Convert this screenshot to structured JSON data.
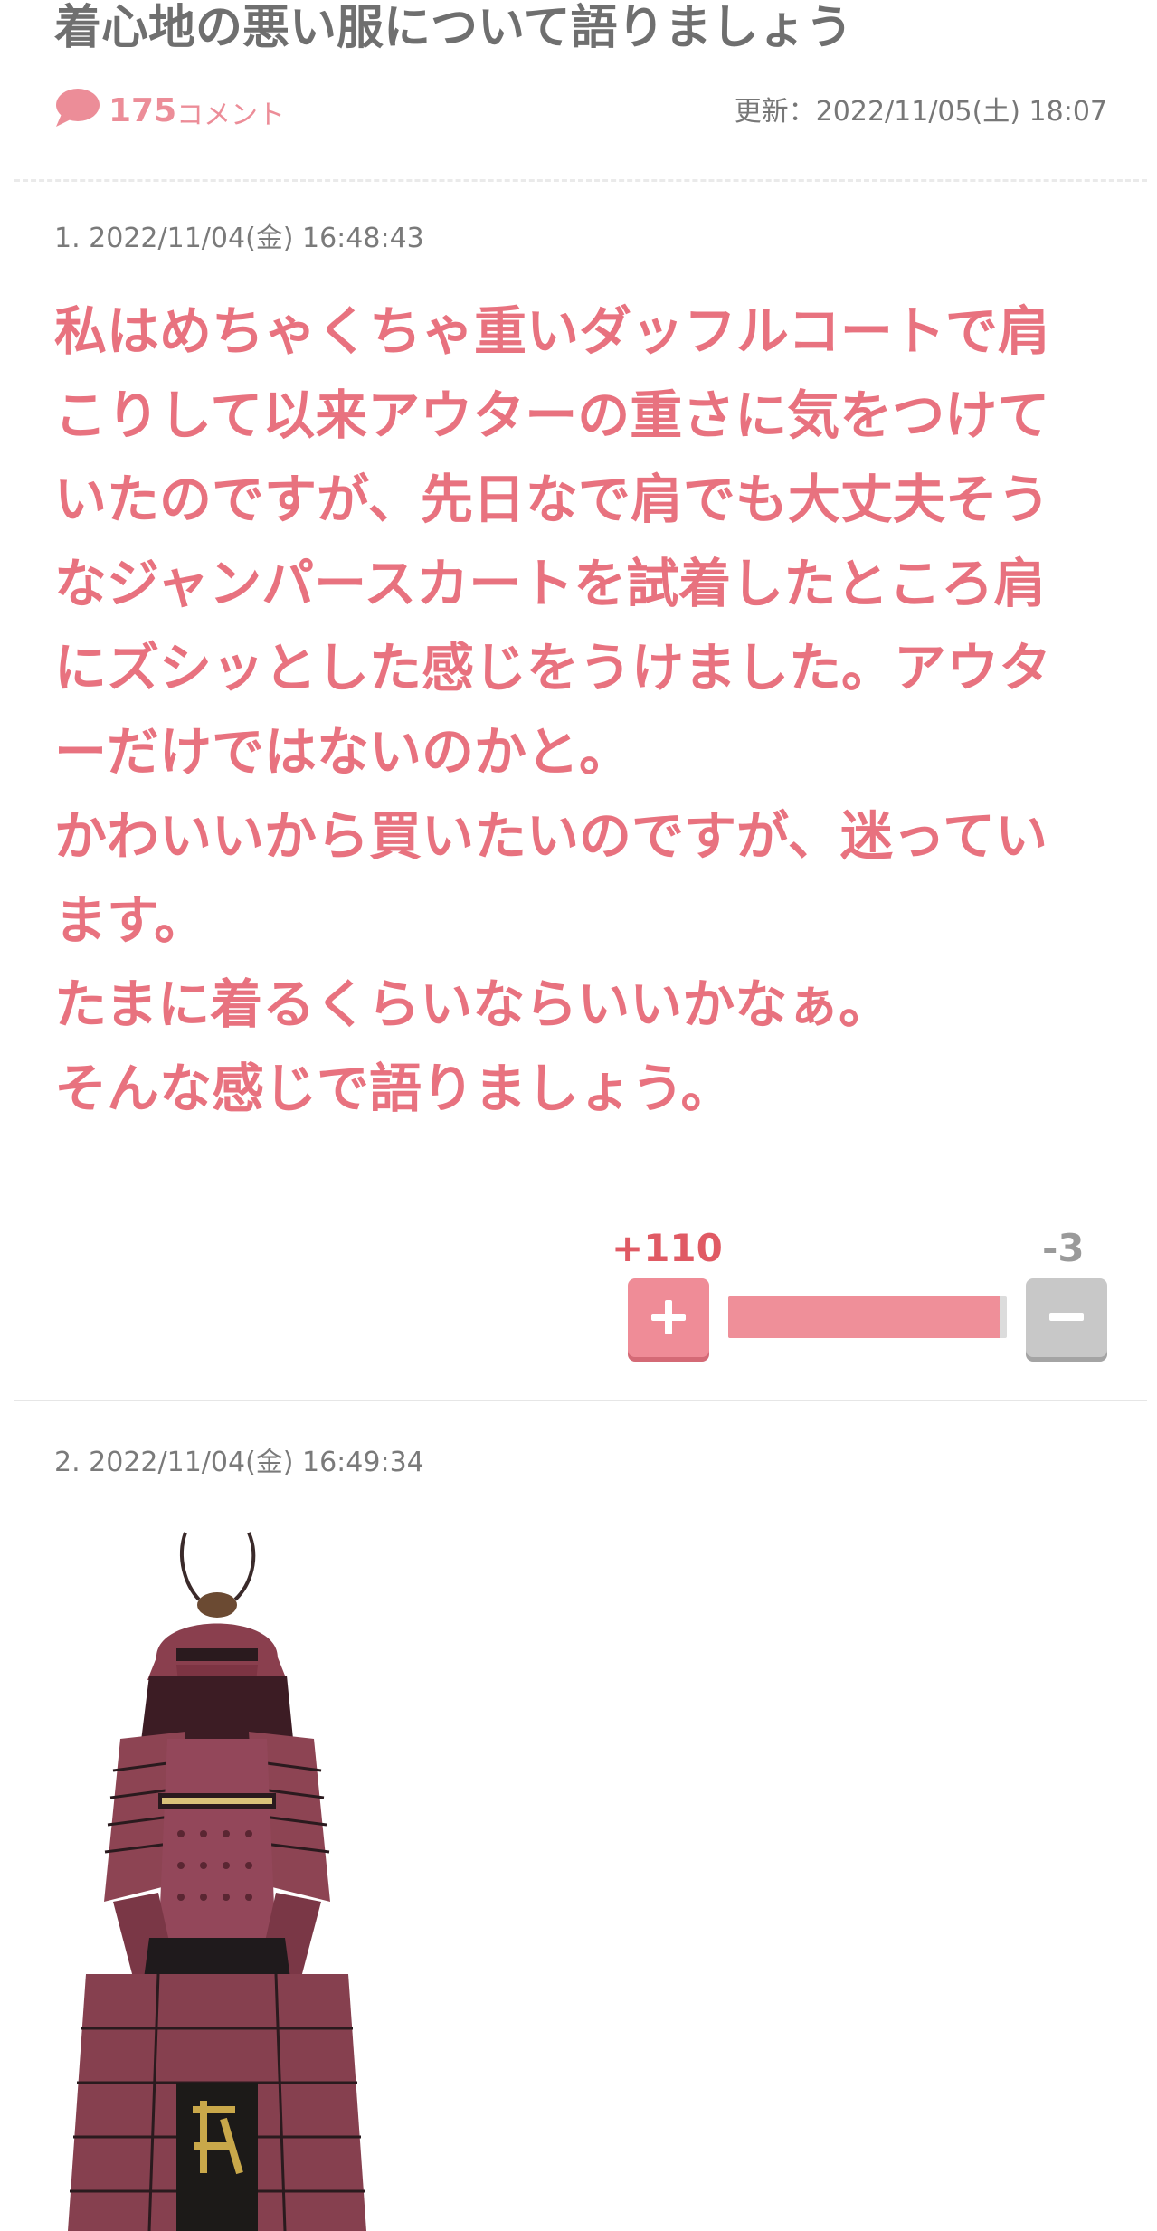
{
  "topic": {
    "title": "着心地の悪い服について語りましょう",
    "comment_count": "175",
    "comment_label": "コメント",
    "updated": "更新：2022/11/05(土) 18:07"
  },
  "posts": [
    {
      "meta": "1. 2022/11/04(金) 16:48:43",
      "lines": [
        "私はめちゃくちゃ重いダッフルコートで肩",
        "こりして以来アウターの重さに気をつけて",
        "いたのですが、先日なで肩でも大丈夫そう",
        "なジャンパースカートを試着したところ肩",
        "にズシッとした感じをうけました。アウタ",
        "ーだけではないのかと。",
        "かわいいから買いたいのですが、迷ってい",
        "ます。",
        "たまに着るくらいならいいかなぁ。",
        "そんな感じで語りましょう。"
      ],
      "plus": "+110",
      "minus": "-3",
      "plus_ratio": 0.973
    },
    {
      "meta": "2. 2022/11/04(金) 16:49:34",
      "image_icon": "samurai-armor-photo"
    }
  ],
  "colors": {
    "accent": "#e8727f",
    "plus_button": "#ef8c97",
    "minus_button": "#c8c8c8",
    "plus_count": "#e05a64",
    "minus_count": "#9a9a9a"
  }
}
